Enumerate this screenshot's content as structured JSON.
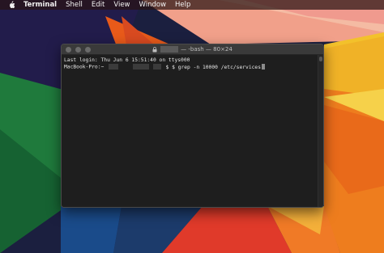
{
  "menubar": {
    "apple_icon": "apple-logo-icon",
    "items": [
      "Terminal",
      "Shell",
      "Edit",
      "View",
      "Window",
      "Help"
    ]
  },
  "window": {
    "title": "— -bash — 80×24",
    "title_icon": "lock-icon",
    "lines": [
      "Last login: Thu Jun  6 15:51:40 on ttys000",
      "MacBook-Pro:~",
      "$ $ grep -n 10000 /etc/services"
    ]
  },
  "colors": {
    "terminal_bg": "#1e1e1e",
    "titlebar_bg": "#3a3a3a",
    "text": "#e6e6e6"
  }
}
